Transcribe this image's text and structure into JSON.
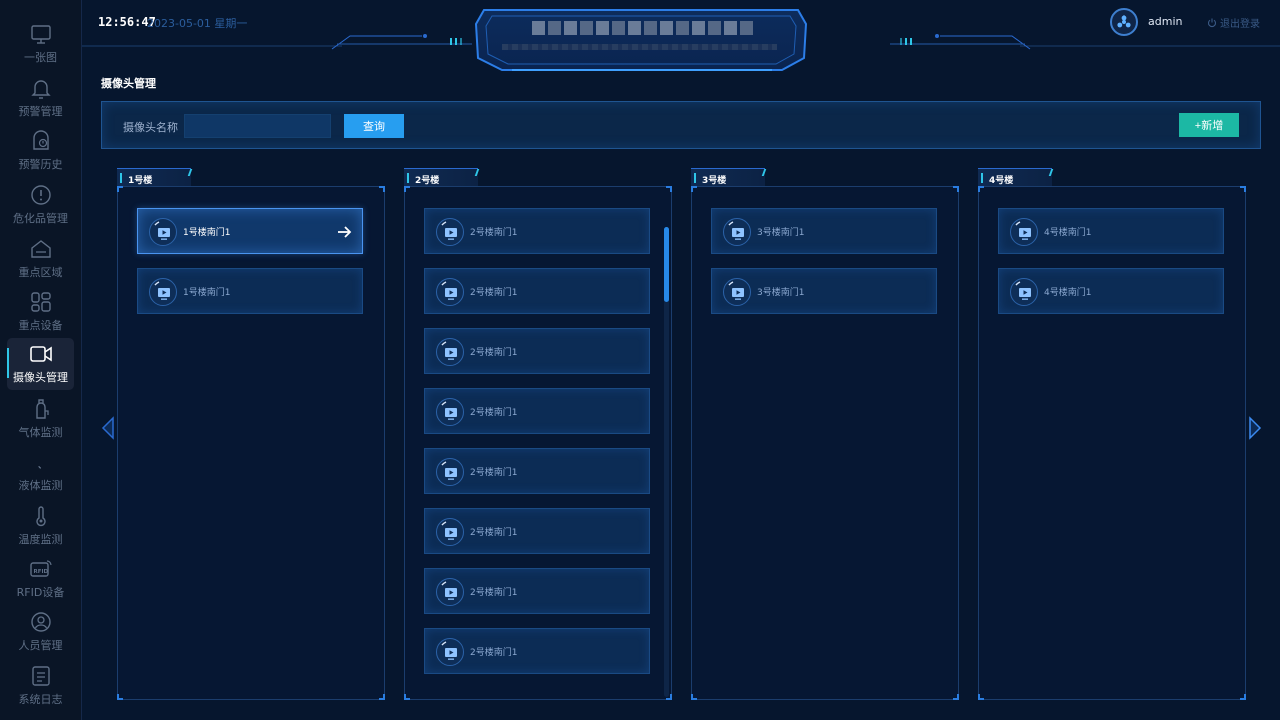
{
  "sidebar": {
    "items": [
      {
        "label": "一张图",
        "icon": "monitor-icon"
      },
      {
        "label": "预警管理",
        "icon": "bell-icon"
      },
      {
        "label": "预警历史",
        "icon": "history-icon"
      },
      {
        "label": "危化品管理",
        "icon": "warning-circle-icon"
      },
      {
        "label": "重点区域",
        "icon": "home-area-icon"
      },
      {
        "label": "重点设备",
        "icon": "device-grid-icon"
      },
      {
        "label": "摄像头管理",
        "icon": "camera-icon",
        "active": true
      },
      {
        "label": "气体监测",
        "icon": "gas-icon"
      },
      {
        "label": "液体监测",
        "icon": "droplet-icon"
      },
      {
        "label": "温度监测",
        "icon": "thermometer-icon"
      },
      {
        "label": "RFID设备",
        "icon": "rfid-icon"
      },
      {
        "label": "人员管理",
        "icon": "person-icon"
      },
      {
        "label": "系统日志",
        "icon": "log-icon"
      }
    ]
  },
  "header": {
    "time": "12:56:47",
    "date": "2023-05-01 星期一",
    "username": "admin",
    "logout_label": "退出登录"
  },
  "page": {
    "title": "摄像头管理"
  },
  "search": {
    "label": "摄像头名称",
    "value": "",
    "query_button": "查询",
    "add_button": "+新增"
  },
  "buildings": [
    {
      "name": "1号楼",
      "cameras": [
        "1号楼南门1",
        "1号楼南门1"
      ],
      "selected": 0
    },
    {
      "name": "2号楼",
      "cameras": [
        "2号楼南门1",
        "2号楼南门1",
        "2号楼南门1",
        "2号楼南门1",
        "2号楼南门1",
        "2号楼南门1",
        "2号楼南门1",
        "2号楼南门1"
      ],
      "scroll_fraction": 0.0
    },
    {
      "name": "3号楼",
      "cameras": [
        "3号楼南门1",
        "3号楼南门1"
      ]
    },
    {
      "name": "4号楼",
      "cameras": [
        "4号楼南门1",
        "4号楼南门1"
      ]
    }
  ],
  "colors": {
    "background": "#06162e",
    "accent": "#2fc6e8",
    "primary_button": "#279ef0",
    "add_button": "#1cb8a4"
  }
}
